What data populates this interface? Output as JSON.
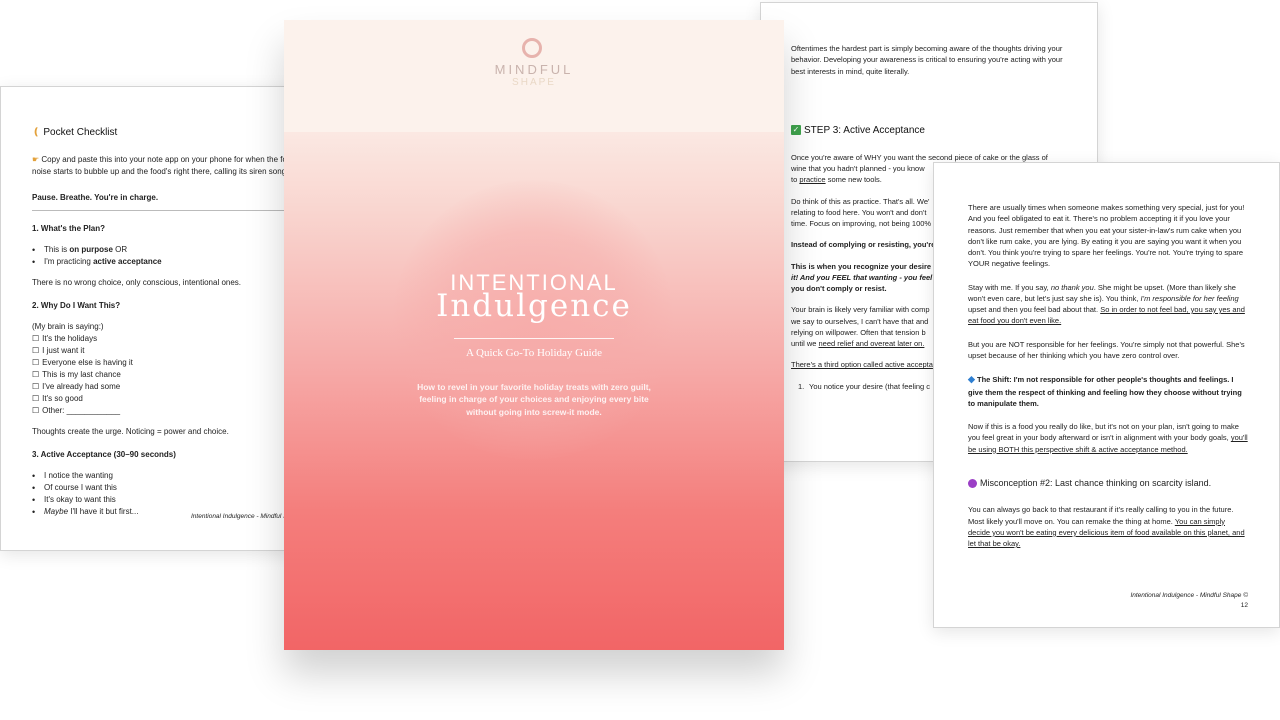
{
  "checklist_page": {
    "title": "Pocket Checklist",
    "title_icon": "hand-icon",
    "intro_icon": "pointing-finger-icon",
    "intro_line1": "Copy and paste this into your note app on your phone for when the fo",
    "intro_line2": "noise starts to bubble up and the food's right there, calling its siren song.",
    "pause": "Pause. Breathe. You're in charge.",
    "section1": "1. What's the Plan?",
    "plan_items": [
      "This is on purpose OR",
      "I'm practicing active acceptance"
    ],
    "no_wrong": "There is no wrong choice, only conscious, intentional ones.",
    "section2": "2. Why Do I Want This?",
    "brain_saying": "(My brain is saying:)",
    "checkbox_glyph": "☐",
    "why_items": [
      "It's the holidays",
      "I just want it",
      "Everyone else is having it",
      "This is my last chance",
      "I've already had some",
      "It's so good",
      "Other: ____________"
    ],
    "thoughts": "Thoughts create the urge. Noticing = power and choice.",
    "section3": "3. Active Acceptance (30–90 seconds)",
    "accept_items": [
      "I notice the wanting",
      "Of course I want this",
      "It's okay to want this",
      "Maybe I'll have it but first..."
    ],
    "footer": "Intentional Indulgence - Mindful S"
  },
  "step_page": {
    "intro": "Oftentimes the hardest part is simply becoming aware of the thoughts driving your behavior. Developing your awareness is critical to ensuring you're acting with your best interests in mind, quite literally.",
    "step_icon": "check-mark-icon",
    "step_title": "STEP 3: Active Acceptance",
    "p1_a": "Once you're aware of WHY you want the second piece of cake or the glass of wine that you hadn't planned - you know",
    "p1_b": "to ",
    "p1_link": "practice",
    "p1_c": " some new tools.",
    "p2": "Do think of this as practice. That's all. We'",
    "p2_b": "relating to food here. You won't and don't",
    "p2_c": "time. Focus on improving, not being 100%",
    "p3": "Instead of complying or resisting, you're",
    "p4_a": "This is when you recognize your desire -",
    "p4_b": "it! And you FEEL that wanting - you feel",
    "p4_c": "you don't comply or resist.",
    "p5_a": "Your brain is likely very familiar with comp",
    "p5_b": "we say to ourselves, I can't have that and",
    "p5_c": "relying on willpower. Often that tension b",
    "p5_d": "until we ",
    "p5_link": "need relief and overeat later on.",
    "p6_link": "There's a third option called active accepta",
    "list_num": "1.",
    "list_item": "You notice your desire (that feeling c"
  },
  "shift_page": {
    "p1": "There are usually times when someone makes something very special, just for you! And you feel obligated to eat it. There's no problem accepting it if you love your reasons. Just remember that when you eat your sister-in-law's rum cake when you don't like rum cake, you are lying. By eating it you are saying you want it when you don't. You think you're trying to spare her feelings. You're not. You're trying to spare YOUR negative feelings.",
    "p2_a": "Stay with me. If you say, ",
    "p2_i1": "no thank you",
    "p2_b": ". She might be upset. (More than likely she won't even care, but let's just say she is). You think, ",
    "p2_i2": "I'm responsible for her feeling",
    "p2_c": " upset and then you feel bad about that. ",
    "p2_u": "So in order to not feel bad, you say yes and eat food you don't even like.",
    "p3": "But you are NOT responsible for her feelings. You're simply not that powerful. She's upset because of her thinking which you have zero control over.",
    "shift_icon": "blue-diamond-icon",
    "shift": "The Shift: I'm not responsible for other people's thoughts and feelings. I give them the respect of thinking and feeling how they choose without trying to manipulate them.",
    "p4_a": "Now if this is a food you really do like, but it's not on your plan, isn't going to make you feel great in your body afterward or isn't in alignment with your body goals, ",
    "p4_u": "you'll be using BOTH this perspective shift & active acceptance method.",
    "misconception_icon": "purple-circle-icon",
    "misconception": "Misconception #2: Last chance thinking on scarcity island.",
    "p5_a": "You can always go back to that restaurant if it's really calling to you in the future. Most likely you'll move on. You can remake the thing at home. ",
    "p5_u": "You can simply decide you won't be eating every delicious item of food available on this planet, and let that be okay.",
    "footer": "Intentional Indulgence - Mindful Shape ©",
    "page_number": "12"
  },
  "cover": {
    "logo_icon": "ring-logo-icon",
    "brand_line1": "MINDFUL",
    "brand_line2": "SHAPE",
    "title_line1": "INTENTIONAL",
    "title_line2": "Indulgence",
    "subtitle": "A Quick Go-To Holiday Guide",
    "description": "How to revel in your favorite holiday treats with zero guilt, feeling in charge of your choices and enjoying every bite without going into screw-it mode."
  }
}
